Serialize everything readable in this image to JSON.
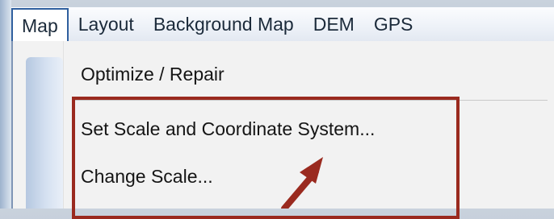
{
  "menubar": {
    "items": [
      {
        "label": "Map"
      },
      {
        "label": "Layout"
      },
      {
        "label": "Background Map"
      },
      {
        "label": "DEM"
      },
      {
        "label": "GPS"
      }
    ]
  },
  "dropdown": {
    "items": [
      {
        "label": "Optimize / Repair"
      },
      {
        "label": "Set Scale and Coordinate System..."
      },
      {
        "label": "Change Scale..."
      }
    ]
  },
  "annotation": {
    "highlight_color": "#9a2a1f"
  }
}
